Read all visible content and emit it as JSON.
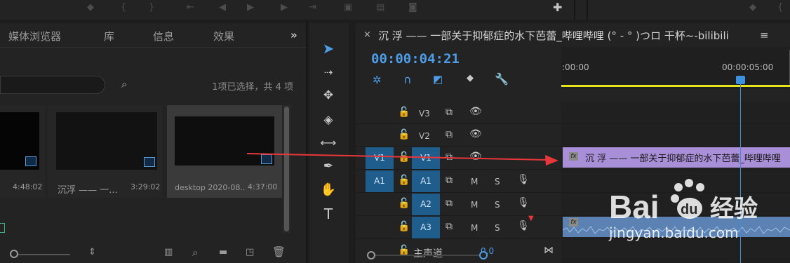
{
  "top_bar": {
    "icons": [
      "marker-icon",
      "in-point-icon",
      "out-point-icon",
      "go-to-in-icon",
      "step-back-icon",
      "play-icon",
      "step-forward-icon",
      "go-to-out-icon",
      "lift-icon",
      "extract-icon",
      "export-frame-icon",
      "add-icon"
    ]
  },
  "project_panel": {
    "tabs": [
      "媒体浏览器",
      "库",
      "信息",
      "效果"
    ],
    "overflow": "»",
    "selection_info": "1项已选择，共 4 项",
    "items": [
      {
        "name": "",
        "duration": "4:48:02"
      },
      {
        "name": "沉浮 —— 一...",
        "duration": "3:29:02"
      },
      {
        "name": "desktop 2020-08...",
        "duration": "4:37:00"
      }
    ]
  },
  "tools": [
    "selection-tool-icon",
    "track-select-icon",
    "ripple-edit-icon",
    "razor-icon",
    "slip-icon",
    "pen-icon",
    "hand-icon",
    "type-icon"
  ],
  "timeline": {
    "close": "×",
    "title": "沉 浮 —— 一部关于抑郁症的水下芭蕾_哔哩哔哩 (° - ° )つロ 干杯~-bilibili",
    "menu": "≡",
    "timecode": "00:00:04:21",
    "ruler_start": ":00:00",
    "ruler_mark": "00:00:05:00",
    "tracks": [
      {
        "target": "",
        "label": "V3",
        "kind": "video"
      },
      {
        "target": "",
        "label": "V2",
        "kind": "video"
      },
      {
        "target": "V1",
        "label": "V1",
        "kind": "video"
      },
      {
        "target": "A1",
        "label": "A1",
        "kind": "audio"
      },
      {
        "target": "",
        "label": "A2",
        "kind": "audio"
      },
      {
        "target": "",
        "label": "A3",
        "kind": "audio"
      }
    ],
    "m_label": "M",
    "s_label": "S",
    "master": "主声道",
    "master_value": "0.0",
    "clip_video_name": "沉 浮 —— 一部关于抑郁症的水下芭蕾_哔哩哔哩",
    "fx": "fx"
  },
  "watermark": "jingyan.baidu.com",
  "colors": {
    "accent": "#4d9de8",
    "target": "#1f5d8c",
    "video_clip": "#a98ed8",
    "audio_clip": "#5b82b2",
    "arrow": "#e8373b"
  }
}
